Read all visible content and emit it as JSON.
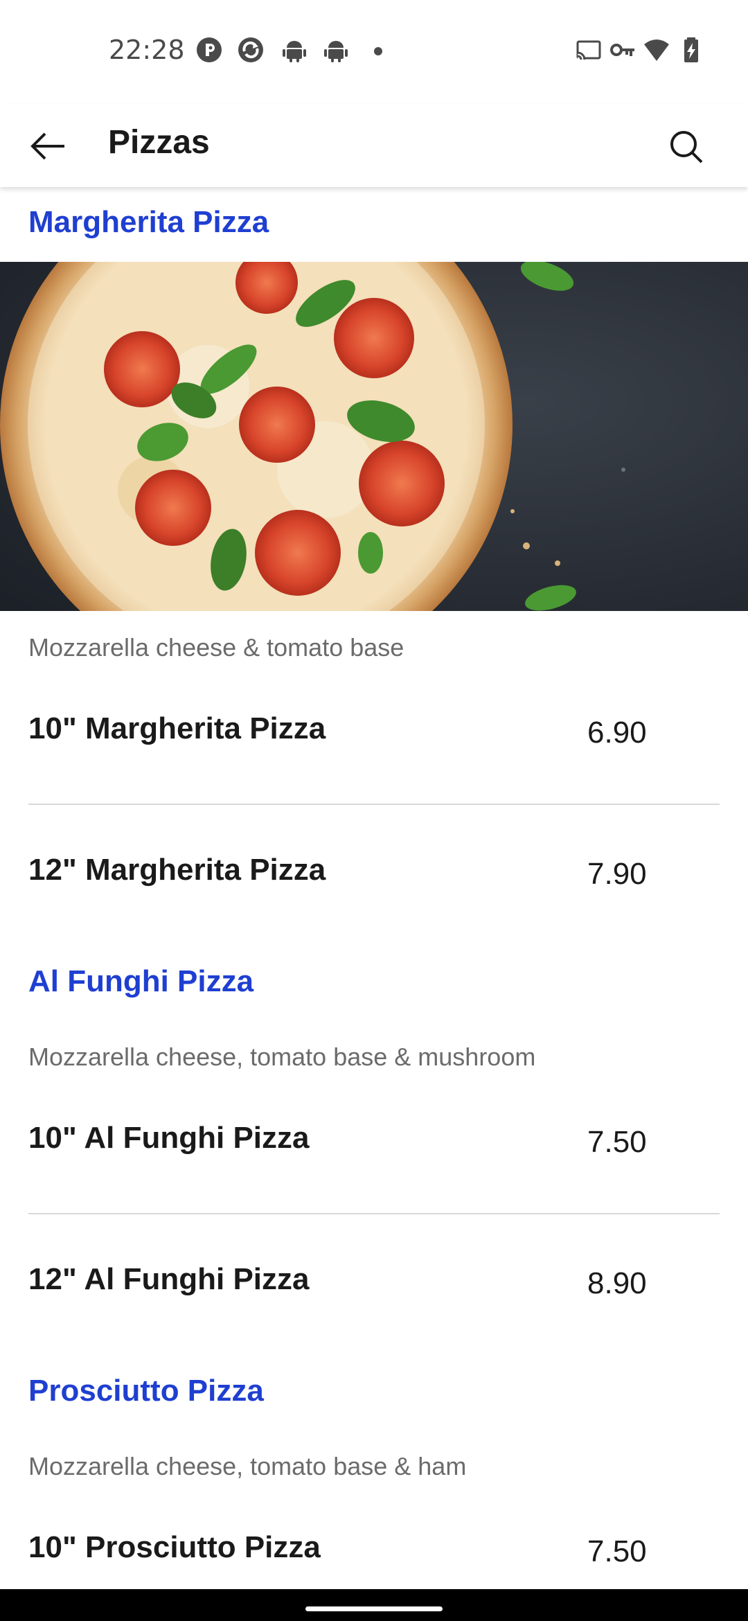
{
  "status_bar": {
    "time": "22:28",
    "left_icons": [
      "app-p-icon",
      "sync-icon",
      "android-icon",
      "android-icon",
      "dot-icon"
    ],
    "right_icons": [
      "cast-icon",
      "key-icon",
      "wifi-icon",
      "battery-charging-icon"
    ]
  },
  "app_bar": {
    "title": "Pizzas",
    "back_icon": "arrow-left-icon",
    "search_icon": "search-icon"
  },
  "colors": {
    "accent": "#1f3fd1",
    "text": "#1a1a1a",
    "muted": "#6b6b6b",
    "divider": "#d8d8d8"
  },
  "sections": [
    {
      "title": "Margherita Pizza",
      "description": "Mozzarella cheese & tomato base",
      "items": [
        {
          "name": "10\" Margherita Pizza",
          "price": "6.90"
        },
        {
          "name": "12\" Margherita Pizza",
          "price": "7.90"
        }
      ]
    },
    {
      "title": "Al Funghi Pizza",
      "description": "Mozzarella cheese, tomato base & mushroom",
      "items": [
        {
          "name": "10\" Al Funghi Pizza",
          "price": "7.50"
        },
        {
          "name": "12\" Al Funghi Pizza",
          "price": "8.90"
        }
      ]
    },
    {
      "title": "Prosciutto Pizza",
      "description": "Mozzarella cheese, tomato base & ham",
      "items": [
        {
          "name": "10\" Prosciutto Pizza",
          "price": "7.50"
        }
      ]
    }
  ]
}
